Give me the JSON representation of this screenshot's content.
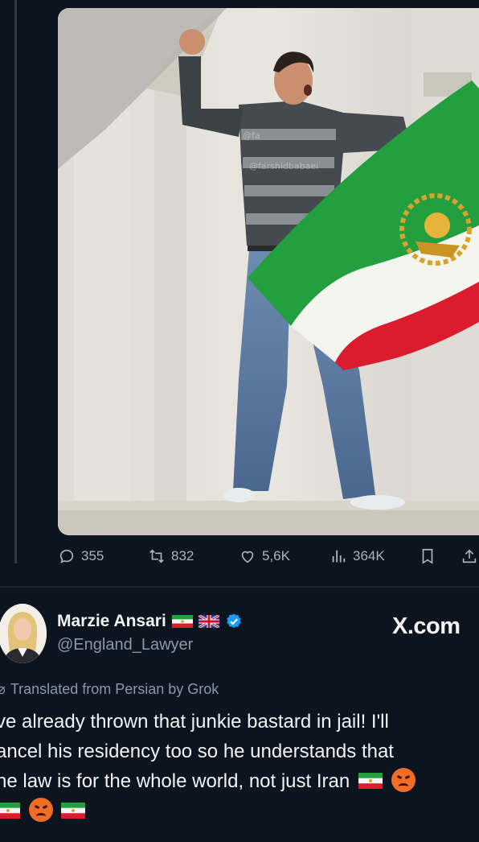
{
  "photo": {
    "watermark": "@farshidbabaei",
    "watermark_faint": "@fa"
  },
  "actions": {
    "replies": "355",
    "reposts": "832",
    "likes": "5,6K",
    "views": "364K"
  },
  "quoted_post": {
    "author_name": "Marzie Ansari",
    "handle": "@England_Lawyer",
    "site_tag": "X.com",
    "translated_label": "Translated from Persian by Grok",
    "lines": [
      "ve already thrown that junkie bastard in jail! I'll",
      "ancel his residency too so he understands that",
      "he law is for the whole world, not just Iran"
    ]
  },
  "colors": {
    "background": "#0c1420",
    "muted_text": "#8b98a5",
    "verified_blue": "#1d9bf0",
    "flag_green": "#239f40",
    "flag_red": "#da1c2e"
  },
  "icons": [
    "reply-icon",
    "repost-icon",
    "like-icon",
    "views-icon",
    "bookmark-icon",
    "share-icon",
    "verified-icon",
    "grok-icon"
  ]
}
